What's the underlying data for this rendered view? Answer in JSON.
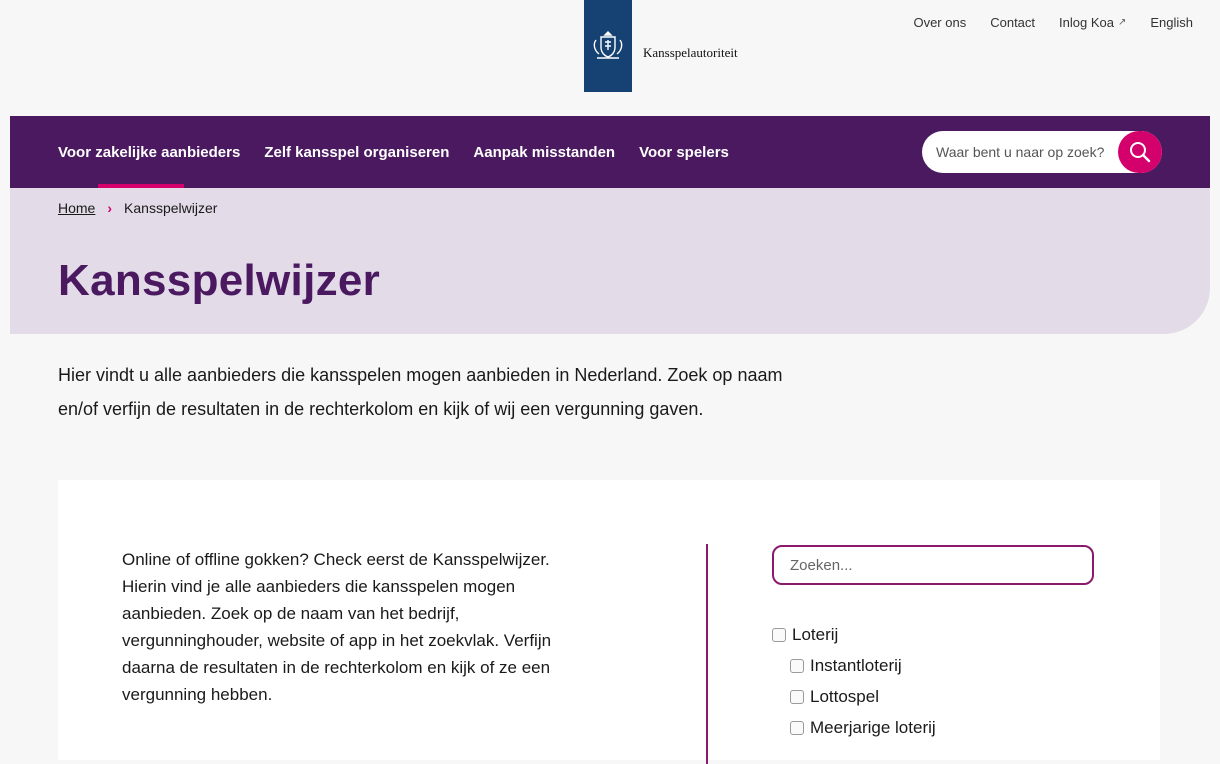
{
  "header": {
    "logo_name": "Kansspelautoriteit",
    "utility_nav": [
      {
        "label": "Over ons",
        "external": false
      },
      {
        "label": "Contact",
        "external": false
      },
      {
        "label": "Inlog Koa",
        "external": true
      },
      {
        "label": "English",
        "external": false
      }
    ]
  },
  "main_nav": {
    "items": [
      {
        "label": "Voor zakelijke aanbieders",
        "active": true
      },
      {
        "label": "Zelf kansspel organiseren",
        "active": false
      },
      {
        "label": "Aanpak misstanden",
        "active": false
      },
      {
        "label": "Voor spelers",
        "active": false
      }
    ],
    "search_placeholder": "Waar bent u naar op zoek?"
  },
  "breadcrumb": {
    "home": "Home",
    "current": "Kansspelwijzer"
  },
  "page": {
    "title": "Kansspelwijzer",
    "intro": "Hier vindt u alle aanbieders die kansspelen mogen aanbieden in Nederland. Zoek op naam en/of verfijn de resultaten in de rechterkolom en kijk of wij een vergunning gaven."
  },
  "card": {
    "text": "Online of offline gokken? Check eerst de Kansspelwijzer. Hierin vind je alle aanbieders die kansspelen mogen aanbieden. Zoek op de naam van het bedrijf, vergunninghouder, website of app in het zoekvlak. Verfijn daarna de resultaten in de rechterkolom en kijk of ze een vergunning hebben.",
    "search_placeholder": "Zoeken...",
    "filters": [
      {
        "label": "Loterij",
        "level": 0,
        "checked": false
      },
      {
        "label": "Instantloterij",
        "level": 1,
        "checked": false
      },
      {
        "label": "Lottospel",
        "level": 1,
        "checked": false
      },
      {
        "label": "Meerjarige loterij",
        "level": 1,
        "checked": false
      }
    ]
  },
  "colors": {
    "brand_purple": "#4a1960",
    "accent_pink": "#d4006c",
    "hero_bg": "#e3dbe8",
    "logo_blue": "#154273"
  }
}
